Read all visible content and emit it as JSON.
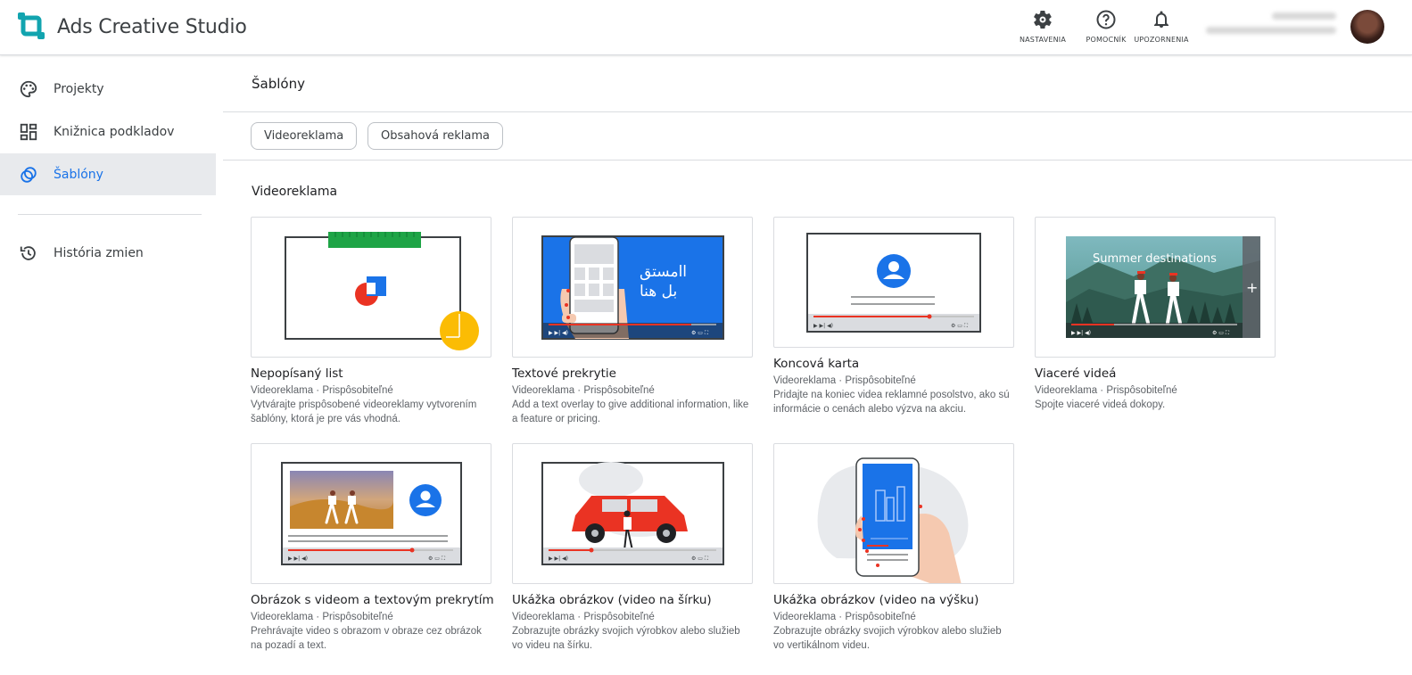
{
  "app": {
    "title": "Ads Creative Studio"
  },
  "topbar": {
    "settings_label": "NASTAVENIA",
    "help_label": "POMOCNÍK",
    "notifications_label": "UPOZORNENIA"
  },
  "sidebar": {
    "items": [
      {
        "label": "Projekty",
        "icon": "palette-icon"
      },
      {
        "label": "Knižnica podkladov",
        "icon": "dashboard-icon"
      },
      {
        "label": "Šablóny",
        "icon": "templates-icon",
        "active": true
      },
      {
        "label": "História zmien",
        "icon": "history-icon"
      }
    ]
  },
  "main": {
    "title": "Šablóny",
    "chips": [
      "Videoreklama",
      "Obsahová reklama"
    ],
    "section_title": "Videoreklama",
    "cards": [
      {
        "title": "Nepopísaný list",
        "meta": "Videoreklama · Prispôsobiteľné",
        "desc": "Vytvárajte prispôsobené videoreklamy vytvorením šablóny, ktorá je pre vás vhodná."
      },
      {
        "title": "Textové prekrytie",
        "meta": "Videoreklama · Prispôsobiteľné",
        "desc": "Add a text overlay to give additional information, like a feature or pricing.",
        "overlay_text_1": "اامستق",
        "overlay_text_2": "بل هنا"
      },
      {
        "title": "Koncová karta",
        "meta": "Videoreklama · Prispôsobiteľné",
        "desc": "Pridajte na koniec videa reklamné posolstvo, ako sú informácie o cenách alebo výzva na akciu."
      },
      {
        "title": "Viaceré videá",
        "meta": "Videoreklama · Prispôsobiteľné",
        "desc": "Spojte viaceré videá dokopy.",
        "overlay_text": "Summer destinations"
      },
      {
        "title": "Obrázok s videom a textovým prekrytím",
        "meta": "Videoreklama · Prispôsobiteľné",
        "desc": "Prehrávajte video s obrazom v obraze cez obrázok na pozadí a text."
      },
      {
        "title": "Ukážka obrázkov (video na šírku)",
        "meta": "Videoreklama · Prispôsobiteľné",
        "desc": "Zobrazujte obrázky svojich výrobkov alebo služieb vo videu na šírku."
      },
      {
        "title": "Ukážka obrázkov (video na výšku)",
        "meta": "Videoreklama · Prispôsobiteľné",
        "desc": "Zobrazujte obrázky svojich výrobkov alebo služieb vo vertikálnom videu."
      }
    ]
  },
  "colors": {
    "accent": "#1a73e8",
    "active_bg": "#e8eaed",
    "brand_teal": "#12a4af",
    "progress_red": "#ea3323"
  }
}
